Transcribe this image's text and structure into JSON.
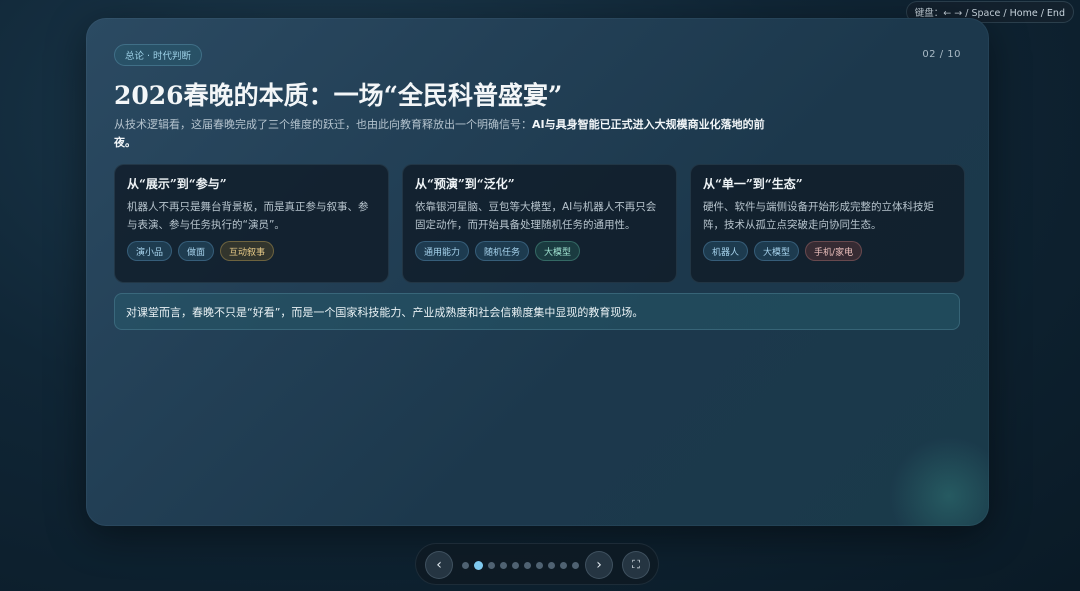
{
  "keyboard_hint": "键盘：← → / Space / Home / End",
  "slide": {
    "section_tag": "总论 · 时代判断",
    "page_number": "02 / 10",
    "title": "2026春晚的本质：一场“全民科普盛宴”",
    "lead_text": "从技术逻辑看，这届春晚完成了三个维度的跃迁，也由此向教育释放出一个明确信号：",
    "lead_strong": "AI与具身智能已正式进入大规模商业化落地的前夜。",
    "cards": [
      {
        "title": "从“展示”到“参与”",
        "body": "机器人不再只是舞台背景板，而是真正参与叙事、参与表演、参与任务执行的“演员”。",
        "chips": [
          "演小品",
          "做面",
          "互动叙事"
        ]
      },
      {
        "title": "从“预演”到“泛化”",
        "body": "依靠银河星脑、豆包等大模型，AI与机器人不再只会固定动作，而开始具备处理随机任务的通用性。",
        "chips": [
          "通用能力",
          "随机任务",
          "大模型"
        ]
      },
      {
        "title": "从“单一”到“生态”",
        "body": "硬件、软件与端侧设备开始形成完整的立体科技矩阵，技术从孤立点突破走向协同生态。",
        "chips": [
          "机器人",
          "大模型",
          "手机/家电"
        ]
      }
    ],
    "callout": "对课堂而言，春晚不只是“好看”，而是一个国家科技能力、产业成熟度和社会信赖度集中显现的教育现场。"
  },
  "nav": {
    "prev_icon": "‹",
    "next_icon": "›",
    "fullscreen_icon": "⛶",
    "total_slides": 10,
    "current_slide": 2
  },
  "colors": {
    "accent": "#7fc9ef",
    "chip_gold": "#e6c987",
    "chip_teal": "#9fe0cf",
    "chip_rose": "#ecc0bd"
  }
}
